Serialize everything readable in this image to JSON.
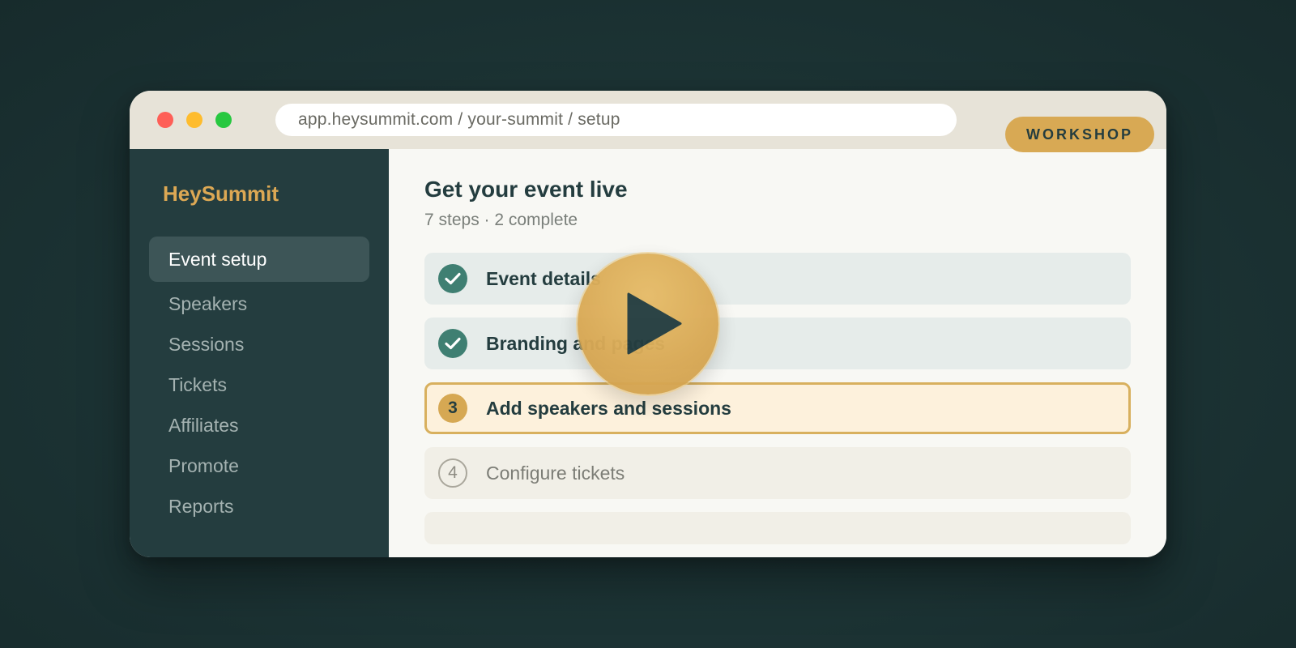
{
  "browser": {
    "url": "app.heysummit.com / your-summit / setup"
  },
  "sidebar": {
    "brand": "HeySummit",
    "items": [
      {
        "label": "Event setup",
        "active": true
      },
      {
        "label": "Speakers"
      },
      {
        "label": "Sessions"
      },
      {
        "label": "Tickets"
      },
      {
        "label": "Affiliates"
      },
      {
        "label": "Promote"
      },
      {
        "label": "Reports"
      }
    ]
  },
  "main": {
    "title": "Get your event live",
    "subtitle": "7 steps · 2 complete",
    "steps": [
      {
        "label": "Event details",
        "status": "complete",
        "icon": "check-icon"
      },
      {
        "label": "Branding and pages",
        "status": "complete",
        "icon": "check-icon"
      },
      {
        "label": "Add speakers and sessions",
        "status": "current",
        "number": "3"
      },
      {
        "label": "Configure tickets",
        "status": "todo",
        "number": "4"
      },
      {
        "label": "",
        "status": "todo"
      }
    ]
  },
  "badge": {
    "label": "WORKSHOP"
  },
  "overlay": {
    "icon": "play-icon"
  },
  "colors": {
    "background": "#1c3334",
    "sidebar": "#243d3f",
    "accent": "#d8a954",
    "complete": "#3f7f72"
  }
}
